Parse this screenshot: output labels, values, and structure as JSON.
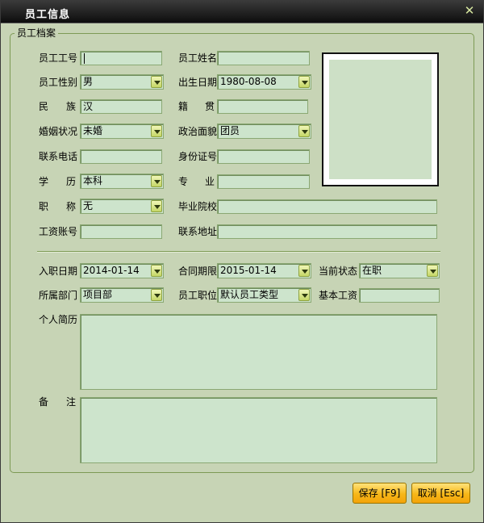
{
  "window": {
    "title": "员工信息",
    "close_symbol": "✕"
  },
  "group_legend": "员工档案",
  "fields": {
    "employee_id": {
      "label": "员工工号",
      "value": ""
    },
    "employee_name": {
      "label": "员工姓名",
      "value": ""
    },
    "gender": {
      "label": "员工性别",
      "value": "男"
    },
    "birth_date": {
      "label": "出生日期",
      "value": "1980-08-08"
    },
    "ethnicity": {
      "label_a": "民",
      "label_b": "族",
      "value": "汉"
    },
    "native_place": {
      "label_a": "籍",
      "label_b": "贯",
      "value": ""
    },
    "marital_status": {
      "label": "婚姻状况",
      "value": "未婚"
    },
    "political_status": {
      "label": "政治面貌",
      "value": "团员"
    },
    "phone": {
      "label": "联系电话",
      "value": ""
    },
    "id_number": {
      "label": "身份证号",
      "value": ""
    },
    "education": {
      "label_a": "学",
      "label_b": "历",
      "value": "本科"
    },
    "major": {
      "label_a": "专",
      "label_b": "业",
      "value": ""
    },
    "title": {
      "label_a": "职",
      "label_b": "称",
      "value": "无"
    },
    "school": {
      "label": "毕业院校",
      "value": ""
    },
    "salary_account": {
      "label": "工资账号",
      "value": ""
    },
    "address": {
      "label": "联系地址",
      "value": ""
    },
    "hire_date": {
      "label": "入职日期",
      "value": "2014-01-14"
    },
    "contract_end": {
      "label": "合同期限",
      "value": "2015-01-14"
    },
    "current_status": {
      "label": "当前状态",
      "value": "在职"
    },
    "department": {
      "label": "所属部门",
      "value": "项目部"
    },
    "position": {
      "label": "员工职位",
      "value": "默认员工类型"
    },
    "base_salary": {
      "label": "基本工资",
      "value": ""
    },
    "resume": {
      "label": "个人简历"
    },
    "remarks": {
      "label_a": "备",
      "label_b": "注"
    }
  },
  "buttons": {
    "save": "保存 [F9]",
    "cancel": "取消 [Esc]"
  }
}
